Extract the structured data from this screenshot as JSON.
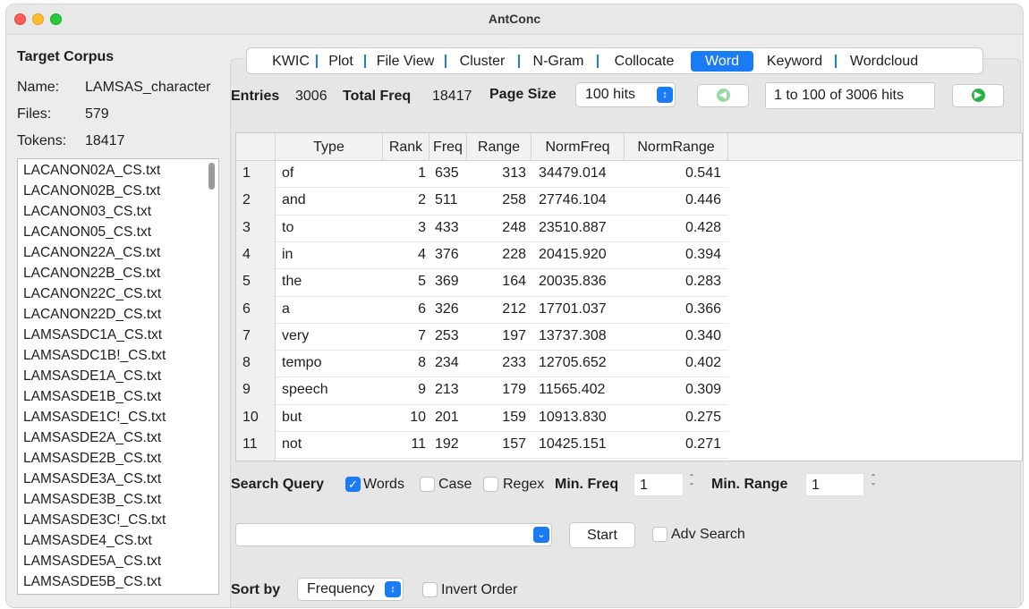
{
  "window": {
    "title": "AntConc"
  },
  "sidebar": {
    "heading": "Target Corpus",
    "name_label": "Name:",
    "name_value": "LAMSAS_character",
    "files_label": "Files:",
    "files_value": "579",
    "tokens_label": "Tokens:",
    "tokens_value": "18417",
    "files": [
      "LACANON02A_CS.txt",
      "LACANON02B_CS.txt",
      "LACANON03_CS.txt",
      "LACANON05_CS.txt",
      "LACANON22A_CS.txt",
      "LACANON22B_CS.txt",
      "LACANON22C_CS.txt",
      "LACANON22D_CS.txt",
      "LAMSASDC1A_CS.txt",
      "LAMSASDC1B!_CS.txt",
      "LAMSASDE1A_CS.txt",
      "LAMSASDE1B_CS.txt",
      "LAMSASDE1C!_CS.txt",
      "LAMSASDE2A_CS.txt",
      "LAMSASDE2B_CS.txt",
      "LAMSASDE3A_CS.txt",
      "LAMSASDE3B_CS.txt",
      "LAMSASDE3C!_CS.txt",
      "LAMSASDE4_CS.txt",
      "LAMSASDE5A_CS.txt",
      "LAMSASDE5B_CS.txt"
    ]
  },
  "tabs": [
    "KWIC",
    "Plot",
    "File View",
    "Cluster",
    "N-Gram",
    "Collocate",
    "Word",
    "Keyword",
    "Wordcloud"
  ],
  "active_tab": "Word",
  "stats": {
    "entries_label": "Entries",
    "entries_value": "3006",
    "total_freq_label": "Total Freq",
    "total_freq_value": "18417",
    "page_size_label": "Page Size",
    "page_size_value": "100 hits",
    "hits_range": "1 to 100 of 3006 hits"
  },
  "table": {
    "columns": [
      "Type",
      "Rank",
      "Freq",
      "Range",
      "NormFreq",
      "NormRange"
    ],
    "rows": [
      {
        "n": "1",
        "type": "of",
        "rank": "1",
        "freq": "635",
        "range": "313",
        "normfreq": "34479.014",
        "normrange": "0.541"
      },
      {
        "n": "2",
        "type": "and",
        "rank": "2",
        "freq": "511",
        "range": "258",
        "normfreq": "27746.104",
        "normrange": "0.446"
      },
      {
        "n": "3",
        "type": "to",
        "rank": "3",
        "freq": "433",
        "range": "248",
        "normfreq": "23510.887",
        "normrange": "0.428"
      },
      {
        "n": "4",
        "type": "in",
        "rank": "4",
        "freq": "376",
        "range": "228",
        "normfreq": "20415.920",
        "normrange": "0.394"
      },
      {
        "n": "5",
        "type": "the",
        "rank": "5",
        "freq": "369",
        "range": "164",
        "normfreq": "20035.836",
        "normrange": "0.283"
      },
      {
        "n": "6",
        "type": "a",
        "rank": "6",
        "freq": "326",
        "range": "212",
        "normfreq": "17701.037",
        "normrange": "0.366"
      },
      {
        "n": "7",
        "type": "very",
        "rank": "7",
        "freq": "253",
        "range": "197",
        "normfreq": "13737.308",
        "normrange": "0.340"
      },
      {
        "n": "8",
        "type": "tempo",
        "rank": "8",
        "freq": "234",
        "range": "233",
        "normfreq": "12705.652",
        "normrange": "0.402"
      },
      {
        "n": "9",
        "type": "speech",
        "rank": "9",
        "freq": "213",
        "range": "179",
        "normfreq": "11565.402",
        "normrange": "0.309"
      },
      {
        "n": "10",
        "type": "but",
        "rank": "10",
        "freq": "201",
        "range": "159",
        "normfreq": "10913.830",
        "normrange": "0.275"
      },
      {
        "n": "11",
        "type": "not",
        "rank": "11",
        "freq": "192",
        "range": "157",
        "normfreq": "10425.151",
        "normrange": "0.271"
      }
    ]
  },
  "search": {
    "label": "Search Query",
    "words_label": "Words",
    "words_checked": true,
    "case_label": "Case",
    "case_checked": false,
    "regex_label": "Regex",
    "regex_checked": false,
    "min_freq_label": "Min. Freq",
    "min_freq_value": "1",
    "min_range_label": "Min. Range",
    "min_range_value": "1",
    "query_value": "",
    "start_label": "Start",
    "adv_search_label": "Adv Search",
    "adv_search_checked": false
  },
  "sort": {
    "label": "Sort by",
    "value": "Frequency",
    "invert_label": "Invert Order",
    "invert_checked": false
  },
  "colors": {
    "accent": "#1a7cf5",
    "nav_button": "#2bb34a"
  },
  "icons": {
    "prev": "arrow-left-circle-icon",
    "next": "arrow-right-circle-icon",
    "select": "up-down-chevron-icon",
    "check": "checkmark-icon"
  }
}
